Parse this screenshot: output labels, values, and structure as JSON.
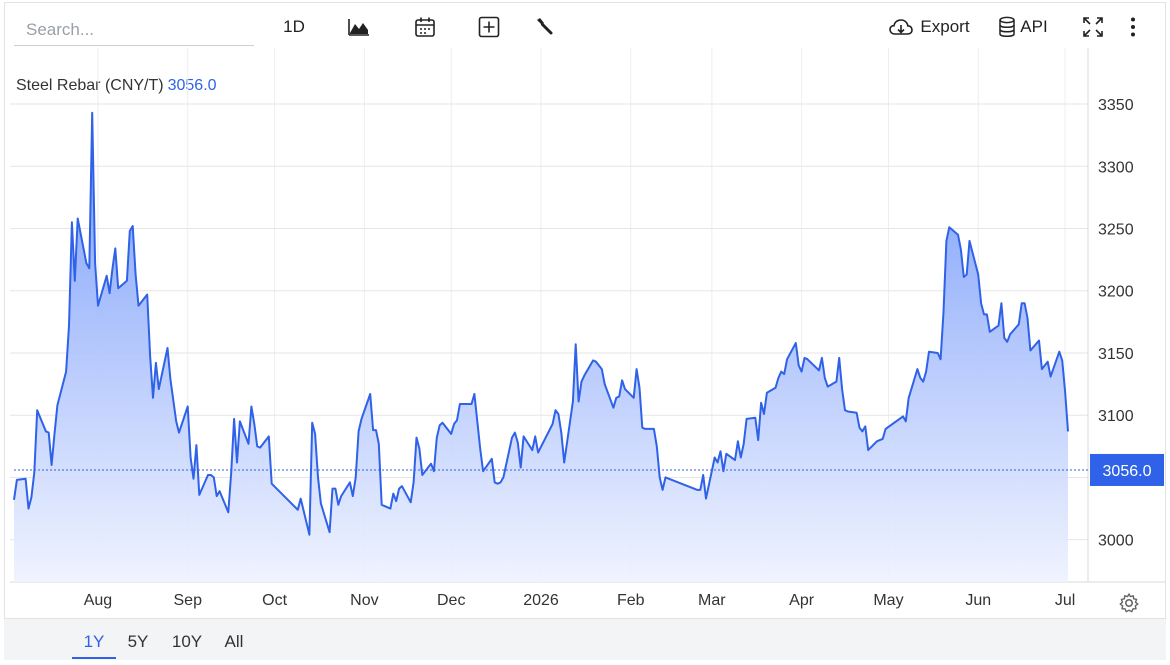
{
  "toolbar": {
    "search_placeholder": "Search...",
    "interval_label": "1D",
    "export_label": "Export",
    "api_label": "API",
    "icons": [
      "mountain-chart-icon",
      "calendar-icon",
      "plus-box-icon",
      "wrench-icon",
      "cloud-download-icon",
      "database-icon",
      "fullscreen-icon",
      "more-vertical-icon"
    ]
  },
  "legend": {
    "name": "Steel Rebar (CNY/T)",
    "value": "3056.0"
  },
  "ranges": [
    {
      "label": "1Y",
      "active": true
    },
    {
      "label": "5Y",
      "active": false
    },
    {
      "label": "10Y",
      "active": false
    },
    {
      "label": "All",
      "active": false
    }
  ],
  "colors": {
    "line": "#2f62e8",
    "fill_top": "#6f95fa",
    "fill_bottom": "#eef2ff",
    "price_tag_bg": "#2f62e8",
    "active": "#2f62e8",
    "grid": "#e6e6e6"
  },
  "chart_data": {
    "type": "area",
    "series": [
      {
        "name": "Steel Rebar (CNY/T)"
      }
    ],
    "last_value": 3056.0,
    "last_value_label": "3056.0",
    "y_ticks": [
      3000,
      3050,
      3100,
      3150,
      3200,
      3250,
      3300,
      3350
    ],
    "y_tick_labels": [
      "3000",
      "",
      "3100",
      "3150",
      "3200",
      "3250",
      "3300",
      "3350"
    ],
    "ylim": [
      2966,
      3395
    ],
    "x_tick_labels": [
      "Aug",
      "Sep",
      "Oct",
      "Nov",
      "Dec",
      "2026",
      "Feb",
      "Mar",
      "Apr",
      "May",
      "Jun",
      "Jul"
    ],
    "x_tick_dates": [
      "2025-08-01",
      "2025-09-01",
      "2025-10-01",
      "2025-11-01",
      "2025-12-01",
      "2026-01-01",
      "2026-02-01",
      "2026-03-01",
      "2026-04-01",
      "2026-05-01",
      "2026-06-01",
      "2026-07-01"
    ],
    "x": [
      "2025-07-03",
      "2025-07-04",
      "2025-07-07",
      "2025-07-08",
      "2025-07-09",
      "2025-07-10",
      "2025-07-11",
      "2025-07-14",
      "2025-07-15",
      "2025-07-16",
      "2025-07-17",
      "2025-07-18",
      "2025-07-21",
      "2025-07-22",
      "2025-07-23",
      "2025-07-24",
      "2025-07-25",
      "2025-07-28",
      "2025-07-29",
      "2025-07-30",
      "2025-07-31",
      "2025-08-01",
      "2025-08-04",
      "2025-08-05",
      "2025-08-06",
      "2025-08-07",
      "2025-08-08",
      "2025-08-11",
      "2025-08-12",
      "2025-08-13",
      "2025-08-14",
      "2025-08-15",
      "2025-08-18",
      "2025-08-19",
      "2025-08-20",
      "2025-08-21",
      "2025-08-22",
      "2025-08-25",
      "2025-08-26",
      "2025-08-27",
      "2025-08-28",
      "2025-08-29",
      "2025-09-01",
      "2025-09-02",
      "2025-09-03",
      "2025-09-04",
      "2025-09-05",
      "2025-09-08",
      "2025-09-09",
      "2025-09-10",
      "2025-09-11",
      "2025-09-12",
      "2025-09-15",
      "2025-09-16",
      "2025-09-17",
      "2025-09-18",
      "2025-09-19",
      "2025-09-22",
      "2025-09-23",
      "2025-09-24",
      "2025-09-25",
      "2025-09-26",
      "2025-09-29",
      "2025-09-30",
      "2025-10-09",
      "2025-10-10",
      "2025-10-13",
      "2025-10-14",
      "2025-10-15",
      "2025-10-16",
      "2025-10-17",
      "2025-10-20",
      "2025-10-21",
      "2025-10-22",
      "2025-10-23",
      "2025-10-24",
      "2025-10-27",
      "2025-10-28",
      "2025-10-29",
      "2025-10-30",
      "2025-10-31",
      "2025-11-03",
      "2025-11-04",
      "2025-11-05",
      "2025-11-06",
      "2025-11-07",
      "2025-11-10",
      "2025-11-11",
      "2025-11-12",
      "2025-11-13",
      "2025-11-14",
      "2025-11-17",
      "2025-11-18",
      "2025-11-19",
      "2025-11-20",
      "2025-11-21",
      "2025-11-24",
      "2025-11-25",
      "2025-11-26",
      "2025-11-27",
      "2025-11-28",
      "2025-12-01",
      "2025-12-02",
      "2025-12-03",
      "2025-12-04",
      "2025-12-05",
      "2025-12-08",
      "2025-12-09",
      "2025-12-10",
      "2025-12-11",
      "2025-12-12",
      "2025-12-15",
      "2025-12-16",
      "2025-12-17",
      "2025-12-18",
      "2025-12-19",
      "2025-12-22",
      "2025-12-23",
      "2025-12-24",
      "2025-12-25",
      "2025-12-26",
      "2025-12-29",
      "2025-12-30",
      "2025-12-31",
      "2026-01-05",
      "2026-01-06",
      "2026-01-07",
      "2026-01-08",
      "2026-01-09",
      "2026-01-12",
      "2026-01-13",
      "2026-01-14",
      "2026-01-15",
      "2026-01-16",
      "2026-01-19",
      "2026-01-20",
      "2026-01-21",
      "2026-01-22",
      "2026-01-23",
      "2026-01-26",
      "2026-01-27",
      "2026-01-28",
      "2026-01-29",
      "2026-01-30",
      "2026-02-02",
      "2026-02-03",
      "2026-02-04",
      "2026-02-05",
      "2026-02-06",
      "2026-02-09",
      "2026-02-10",
      "2026-02-11",
      "2026-02-12",
      "2026-02-13",
      "2026-02-24",
      "2026-02-25",
      "2026-02-26",
      "2026-02-27",
      "2026-03-02",
      "2026-03-03",
      "2026-03-04",
      "2026-03-05",
      "2026-03-06",
      "2026-03-09",
      "2026-03-10",
      "2026-03-11",
      "2026-03-12",
      "2026-03-13",
      "2026-03-16",
      "2026-03-17",
      "2026-03-18",
      "2026-03-19",
      "2026-03-20",
      "2026-03-23",
      "2026-03-24",
      "2026-03-25",
      "2026-03-26",
      "2026-03-27",
      "2026-03-30",
      "2026-03-31",
      "2026-04-01",
      "2026-04-02",
      "2026-04-03",
      "2026-04-07",
      "2026-04-08",
      "2026-04-09",
      "2026-04-10",
      "2026-04-13",
      "2026-04-14",
      "2026-04-15",
      "2026-04-16",
      "2026-04-17",
      "2026-04-20",
      "2026-04-21",
      "2026-04-22",
      "2026-04-23",
      "2026-04-24",
      "2026-04-27",
      "2026-04-28",
      "2026-04-29",
      "2026-04-30",
      "2026-05-06",
      "2026-05-07",
      "2026-05-08",
      "2026-05-11",
      "2026-05-12",
      "2026-05-13",
      "2026-05-14",
      "2026-05-15",
      "2026-05-18",
      "2026-05-19",
      "2026-05-20",
      "2026-05-21",
      "2026-05-22",
      "2026-05-25",
      "2026-05-26",
      "2026-05-27",
      "2026-05-28",
      "2026-05-29",
      "2026-06-01",
      "2026-06-02",
      "2026-06-03",
      "2026-06-04",
      "2026-06-05",
      "2026-06-08",
      "2026-06-09",
      "2026-06-10",
      "2026-06-11",
      "2026-06-12",
      "2026-06-15",
      "2026-06-16",
      "2026-06-17",
      "2026-06-18",
      "2026-06-19",
      "2026-06-22",
      "2026-06-23",
      "2026-06-24",
      "2026-06-25",
      "2026-06-26",
      "2026-06-29",
      "2026-06-30",
      "2026-07-01",
      "2026-07-02"
    ],
    "values": [
      3032,
      3048,
      3049,
      3025,
      3034,
      3054,
      3104,
      3087,
      3086,
      3060,
      3085,
      3108,
      3135,
      3172,
      3255,
      3208,
      3258,
      3222,
      3218,
      3343,
      3222,
      3188,
      3212,
      3198,
      3218,
      3234,
      3202,
      3208,
      3248,
      3252,
      3213,
      3188,
      3197,
      3148,
      3114,
      3142,
      3121,
      3154,
      3129,
      3112,
      3095,
      3086,
      3107,
      3066,
      3049,
      3076,
      3036,
      3052,
      3052,
      3050,
      3035,
      3039,
      3022,
      3054,
      3097,
      3062,
      3095,
      3077,
      3107,
      3093,
      3075,
      3074,
      3083,
      3045,
      3024,
      3033,
      3004,
      3094,
      3085,
      3050,
      3029,
      3006,
      3041,
      3041,
      3028,
      3035,
      3046,
      3035,
      3050,
      3087,
      3097,
      3117,
      3088,
      3088,
      3077,
      3028,
      3025,
      3037,
      3031,
      3041,
      3043,
      3030,
      3046,
      3082,
      3073,
      3052,
      3061,
      3055,
      3082,
      3092,
      3094,
      3085,
      3093,
      3096,
      3109,
      3109,
      3109,
      3117,
      3095,
      3073,
      3055,
      3065,
      3046,
      3045,
      3046,
      3050,
      3082,
      3086,
      3078,
      3058,
      3083,
      3072,
      3083,
      3070,
      3093,
      3104,
      3101,
      3086,
      3062,
      3111,
      3157,
      3111,
      3127,
      3132,
      3144,
      3143,
      3140,
      3137,
      3125,
      3106,
      3114,
      3115,
      3128,
      3121,
      3114,
      3137,
      3122,
      3090,
      3089,
      3089,
      3075,
      3050,
      3040,
      3050,
      3040,
      3040,
      3052,
      3033,
      3066,
      3062,
      3071,
      3055,
      3069,
      3064,
      3079,
      3066,
      3077,
      3097,
      3098,
      3080,
      3110,
      3101,
      3118,
      3122,
      3130,
      3135,
      3133,
      3145,
      3158,
      3140,
      3135,
      3146,
      3145,
      3136,
      3146,
      3130,
      3123,
      3127,
      3146,
      3121,
      3104,
      3103,
      3102,
      3090,
      3087,
      3091,
      3072,
      3079,
      3080,
      3081,
      3089,
      3099,
      3095,
      3114,
      3137,
      3130,
      3127,
      3135,
      3151,
      3150,
      3145,
      3183,
      3240,
      3251,
      3245,
      3233,
      3211,
      3213,
      3240,
      3213,
      3190,
      3181,
      3181,
      3167,
      3172,
      3190,
      3162,
      3159,
      3165,
      3173,
      3190,
      3190,
      3178,
      3152,
      3160,
      3137,
      3140,
      3143,
      3131,
      3151,
      3144,
      3119,
      3087,
      3085,
      3078,
      3076,
      3081,
      3067,
      3060,
      3062,
      3056,
      3056
    ]
  }
}
